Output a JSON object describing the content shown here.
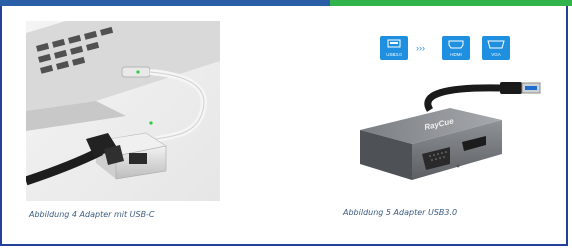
{
  "figures": [
    {
      "caption": "Abbildung 4 Adapter mit USB-C"
    },
    {
      "caption": "Abbildung 5 Adapter USB3.0",
      "badges": [
        "USB3.0",
        "HDMI",
        "VGA"
      ],
      "arrows": "›››",
      "brand": "RayCue"
    }
  ],
  "colors": {
    "topbar_blue": "#2a5fa8",
    "topbar_green": "#2fb34a",
    "border": "#23409a",
    "caption": "#3a5b7f",
    "badge": "#1f8fe0"
  }
}
